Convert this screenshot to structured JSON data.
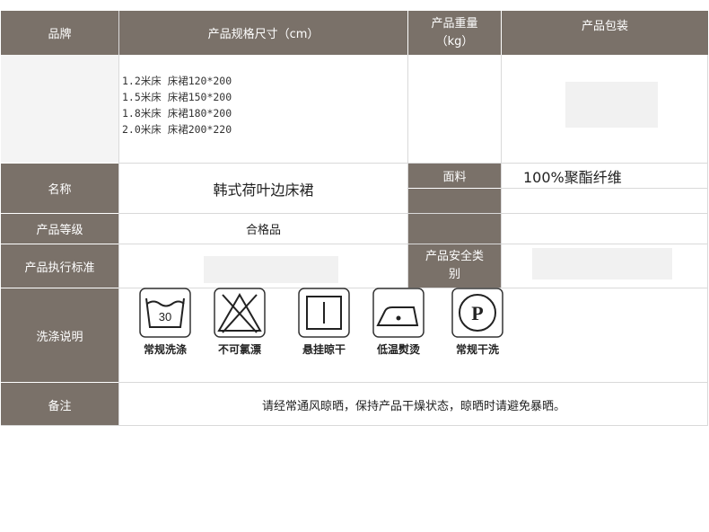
{
  "header": {
    "brand": "品牌",
    "size_spec": "产品规格尺寸（cm）",
    "weight": "产品重量",
    "weight_unit": "（kg）",
    "package": "产品包装"
  },
  "sizes": [
    "1.2米床 床裙120*200",
    "1.5米床 床裙150*200",
    "1.8米床 床裙180*200",
    "2.0米床 床裙200*220"
  ],
  "name_label": "名称",
  "name_value": "韩式荷叶边床裙",
  "fabric_label": "面料",
  "fabric_value": "100%聚酯纤维",
  "grade_label": "产品等级",
  "grade_value": "合格品",
  "standard_label": "产品执行标准",
  "safety_label_1": "产品安全类",
  "safety_label_2": "别",
  "wash_label": "洗涤说明",
  "care": [
    {
      "icon": "washtub-30-icon",
      "label": "常规洗涤",
      "number": "30"
    },
    {
      "icon": "no-bleach-icon",
      "label": "不可氯漂"
    },
    {
      "icon": "hang-dry-icon",
      "label": "悬挂晾干"
    },
    {
      "icon": "low-iron-icon",
      "label": "低温熨烫"
    },
    {
      "icon": "dry-clean-p-icon",
      "label": "常规干洗",
      "letter": "P"
    }
  ],
  "remark_label": "备注",
  "remark_value": "请经常通风晾晒，保持产品干燥状态，晾晒时请避免暴晒。",
  "colors": {
    "header_bg": "#7a7169",
    "header_text": "#ffffff",
    "border": "#d9d9d9"
  }
}
